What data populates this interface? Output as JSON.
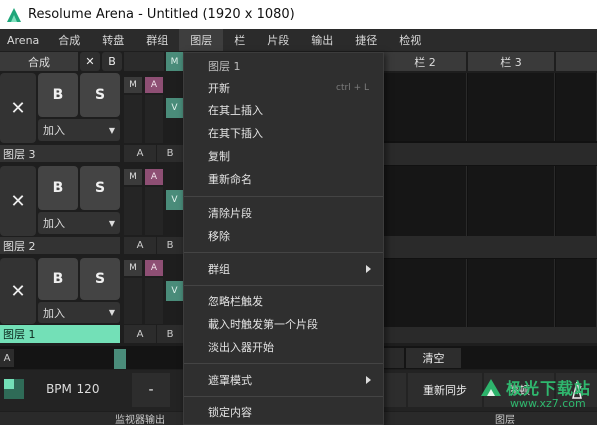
{
  "window": {
    "title": "Resolume Arena - Untitled (1920 x 1080)"
  },
  "menubar": {
    "items": [
      "Arena",
      "合成",
      "转盘",
      "群组",
      "图层",
      "栏",
      "片段",
      "输出",
      "捷径",
      "检视"
    ]
  },
  "header": {
    "composition_label": "合成",
    "close_symbol": "✕",
    "b_label": "B",
    "m_label": "M",
    "columns": [
      "栏 2",
      "栏 3"
    ]
  },
  "layers": [
    {
      "name": "图层 3",
      "blend_mode": "加入"
    },
    {
      "name": "图层 2",
      "blend_mode": "加入"
    },
    {
      "name": "图层 1",
      "blend_mode": "加入"
    }
  ],
  "layer_controls": {
    "b": "B",
    "s": "S",
    "m": "M",
    "a": "A",
    "v": "V",
    "x": "✕",
    "ab_a": "A",
    "ab_b": "B"
  },
  "context_menu": {
    "header": "图层 1",
    "items": [
      {
        "label": "开新",
        "shortcut": "ctrl + L"
      },
      {
        "label": "在其上插入"
      },
      {
        "label": "在其下插入"
      },
      {
        "label": "复制"
      },
      {
        "label": "重新命名"
      },
      {
        "label": "清除片段"
      },
      {
        "label": "移除"
      },
      {
        "label": "群组"
      },
      {
        "label": "忽略栏触发"
      },
      {
        "label": "載入时触发第一个片段"
      },
      {
        "label": "淡出入器开始"
      },
      {
        "label": "遮罩模式"
      },
      {
        "label": "锁定内容"
      }
    ]
  },
  "transport": {
    "a_label": "A",
    "clear_label": "清空",
    "bpm_label": "BPM",
    "bpm_value": "120",
    "minus": "-",
    "resync_label": "重新同步",
    "pause_label": "停顿",
    "monitor_output": "监视器输出",
    "layer_label": "图层"
  },
  "watermark": {
    "text": "极光下载站",
    "url": "www.xz7.com"
  },
  "colors": {
    "accent_green": "#73e0b7",
    "pink": "#8e4f74",
    "teal": "#4a8c7a"
  }
}
